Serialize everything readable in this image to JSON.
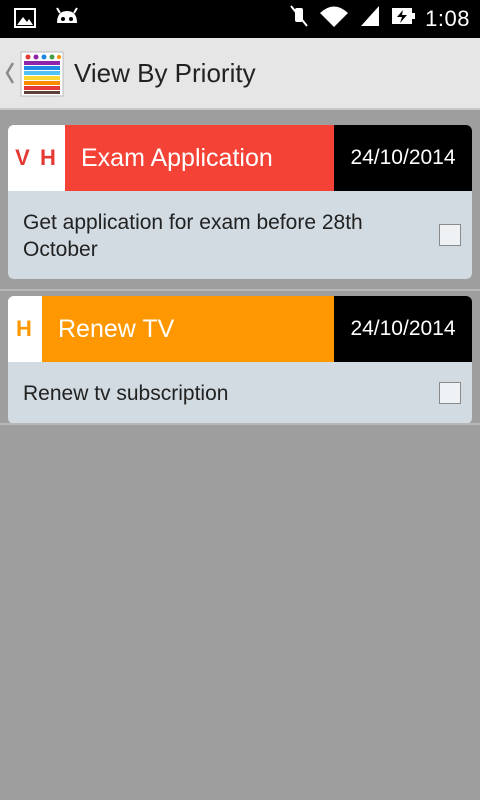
{
  "status_bar": {
    "time": "1:08",
    "icons": [
      "image-icon",
      "android-icon",
      "mute-icon",
      "wifi-icon",
      "signal-icon",
      "battery-charging-icon"
    ]
  },
  "action_bar": {
    "title": "View By Priority",
    "up_icon": "chevron-left-icon",
    "logo_icon": "app-logo-icon"
  },
  "tasks": [
    {
      "priority": "V H",
      "title": "Exam Application",
      "date": "24/10/2014",
      "description": "Get application for exam before 28th October",
      "checked": false,
      "colors": {
        "priority_text": "#e53935",
        "header": "#f44336"
      }
    },
    {
      "priority": "H",
      "title": "Renew TV",
      "date": "24/10/2014",
      "description": "Renew tv subscription",
      "checked": false,
      "colors": {
        "priority_text": "#ff9800",
        "header": "#ff9800"
      }
    }
  ]
}
